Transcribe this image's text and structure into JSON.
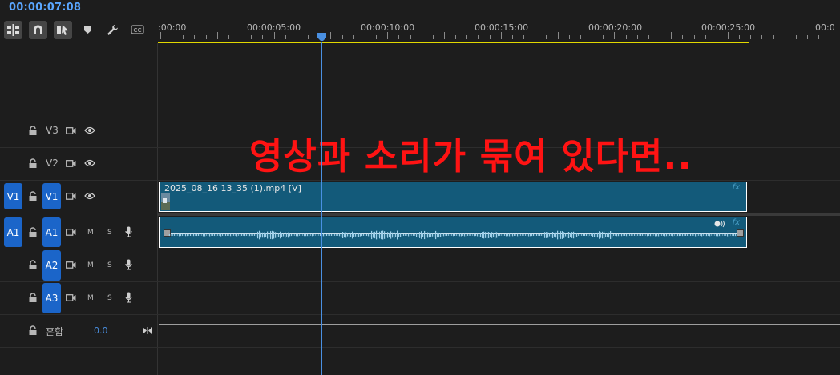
{
  "timecode": "00:00:07:08",
  "ruler": {
    "labels": [
      ":00:00",
      "00:00:05:00",
      "00:00:10:00",
      "00:00:15:00",
      "00:00:20:00",
      "00:00:25:00",
      "00:0"
    ]
  },
  "tracks": {
    "v3": {
      "label": "V3"
    },
    "v2": {
      "label": "V2"
    },
    "v1": {
      "source": "V1",
      "label": "V1"
    },
    "a1": {
      "source": "A1",
      "label": "A1",
      "m": "M",
      "s": "S"
    },
    "a2": {
      "label": "A2",
      "m": "M",
      "s": "S"
    },
    "a3": {
      "label": "A3",
      "m": "M",
      "s": "S"
    },
    "mix": {
      "label": "혼합",
      "value": "0.0"
    }
  },
  "clips": {
    "video": {
      "name": "2025_08_16 13_35 (1).mp4 [V]",
      "fx": "fx"
    },
    "audio": {
      "fx": "fx"
    }
  },
  "caption": "영상과 소리가 묶여 있다면..",
  "colors": {
    "accent": "#1b65c9",
    "timecode": "#5aa6ff",
    "clip": "#135a7a",
    "workarea": "#e2d800",
    "caption": "#ff1313"
  }
}
